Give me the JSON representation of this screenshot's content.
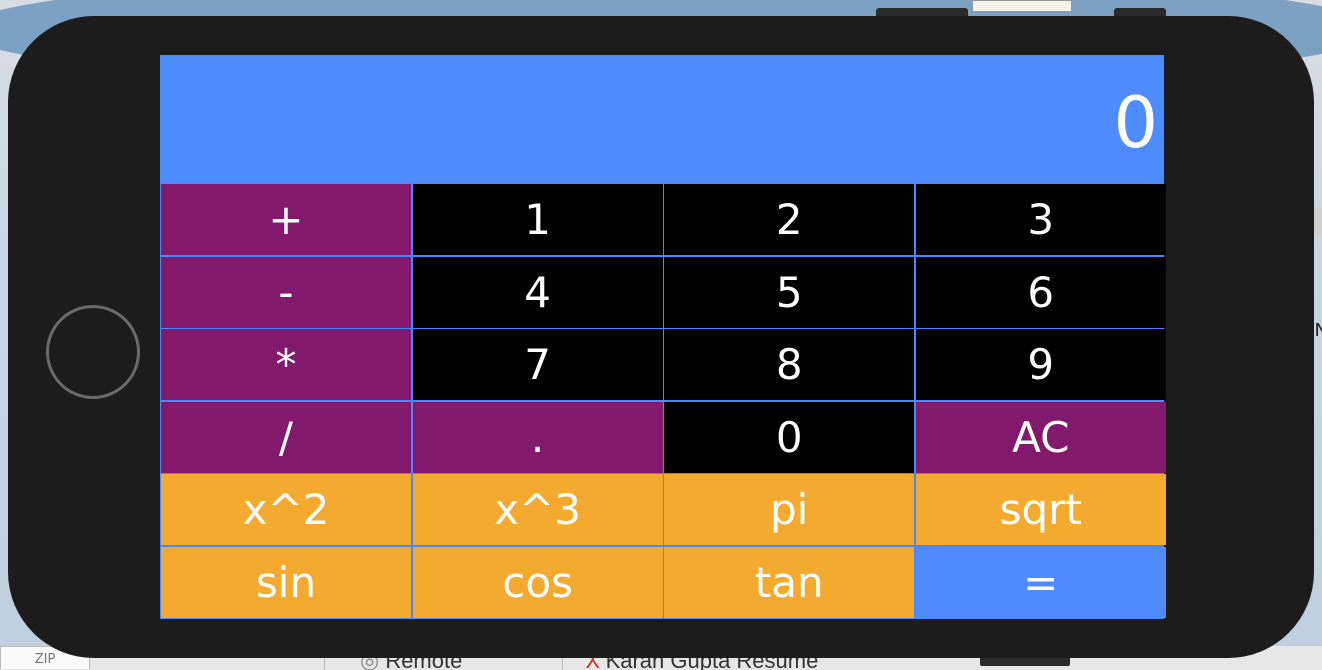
{
  "display": {
    "value": "0"
  },
  "keys": {
    "plus": "+",
    "one": "1",
    "two": "2",
    "three": "3",
    "minus": "-",
    "four": "4",
    "five": "5",
    "six": "6",
    "multiply": "*",
    "seven": "7",
    "eight": "8",
    "nine": "9",
    "divide": "/",
    "decimal": ".",
    "zero": "0",
    "clear": "AC",
    "square": "x^2",
    "cube": "x^3",
    "pi": "pi",
    "sqrt": "sqrt",
    "sin": "sin",
    "cos": "cos",
    "tan": "tan",
    "equals": "="
  },
  "background": {
    "finder_zip": "ZIP",
    "finder_remote": "Remote",
    "finder_resume": "Karan Gupta Resume",
    "edge_letter": "N"
  },
  "colors": {
    "display": "#4d8bff",
    "operator": "#82196d",
    "digit": "#000000",
    "function": "#f3aa2e",
    "equals": "#4d8bff",
    "device": "#1c1c1c"
  }
}
